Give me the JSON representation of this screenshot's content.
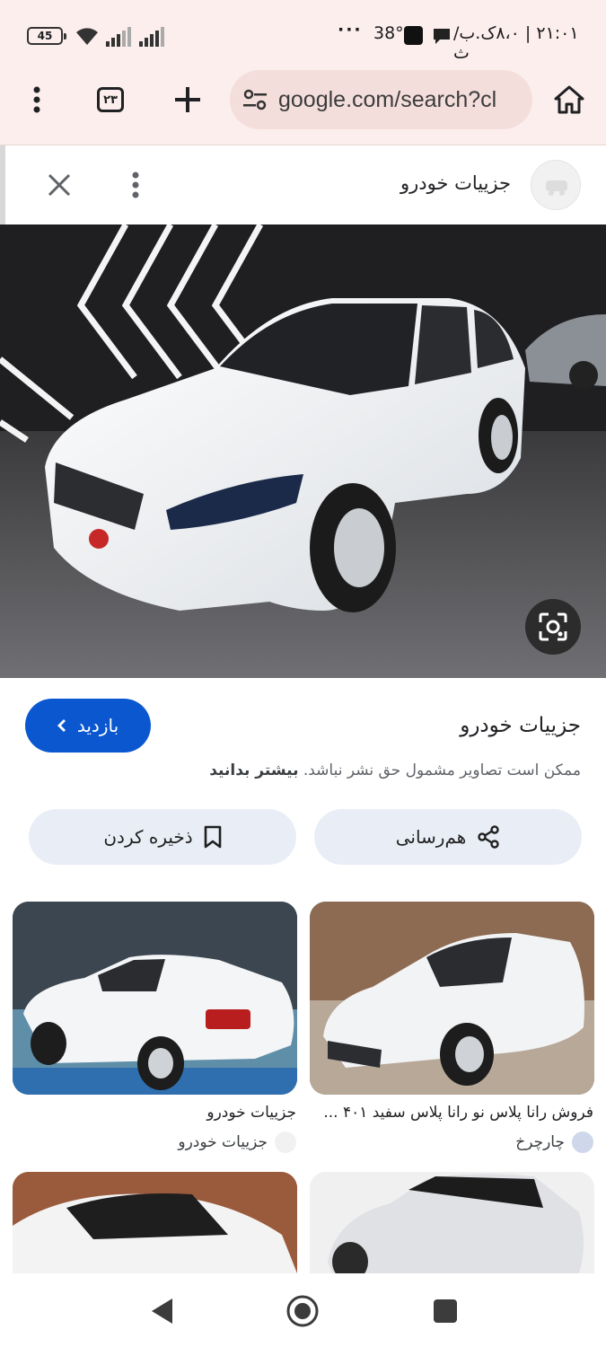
{
  "status_bar": {
    "time_text": "۲۱:۰۱ | ۸،۰ک.ب/ث",
    "temperature": "38°",
    "battery": "45"
  },
  "browser": {
    "url": "google.com/search?cl",
    "tab_count": "۲۳"
  },
  "panel": {
    "header_title": "جزییات خودرو"
  },
  "info": {
    "visit_label": "بازدید",
    "title": "جزییات خودرو",
    "copyright_text": "ممکن است تصاویر مشمول حق نشر نباشد.",
    "learn_more": "بیشتر بدانید",
    "share_label": "هم‌رسانی",
    "save_label": "ذخیره کردن"
  },
  "related": [
    {
      "title": "فروش رانا پلاس نو رانا پلاس سفید ۴۰۱ ...",
      "source": "چارچرخ"
    },
    {
      "title": "جزییات خودرو",
      "source": "جزییات خودرو"
    }
  ],
  "icons": {
    "close": "close-icon",
    "menu": "more-vert-icon",
    "home": "home-icon",
    "lens": "lens-icon",
    "share": "share-icon",
    "bookmark": "bookmark-icon"
  },
  "colors": {
    "chrome_bg": "#fbeeec",
    "url_pill": "#f4dedc",
    "accent": "#0b57d0",
    "pill_bg": "#e9eef6"
  }
}
